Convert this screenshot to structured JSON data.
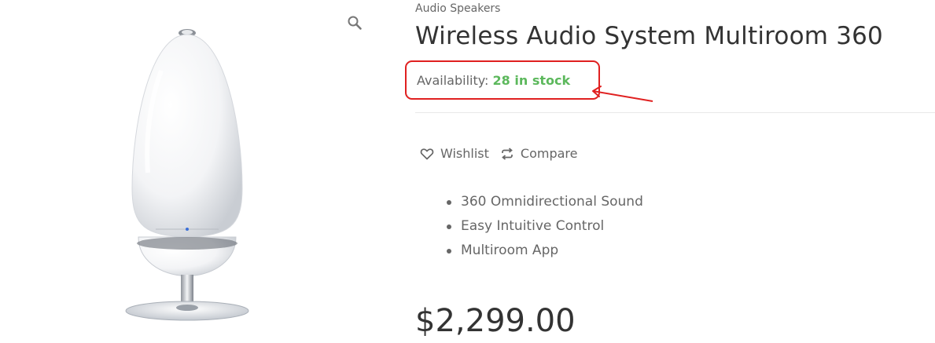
{
  "product": {
    "category": "Audio Speakers",
    "title": "Wireless Audio System Multiroom 360",
    "availability_label": "Availability:",
    "availability_value": "28 in stock",
    "actions": {
      "wishlist": "Wishlist",
      "compare": "Compare"
    },
    "features": [
      "360 Omnidirectional Sound",
      "Easy Intuitive Control",
      "Multiroom App"
    ],
    "price": "$2,299.00"
  },
  "icons": {
    "zoom": "search-icon",
    "wishlist": "heart-icon",
    "compare": "refresh-icon"
  },
  "colors": {
    "stock": "#5cb85c",
    "annotation": "#e02020",
    "text": "#333333",
    "muted": "#666666"
  }
}
